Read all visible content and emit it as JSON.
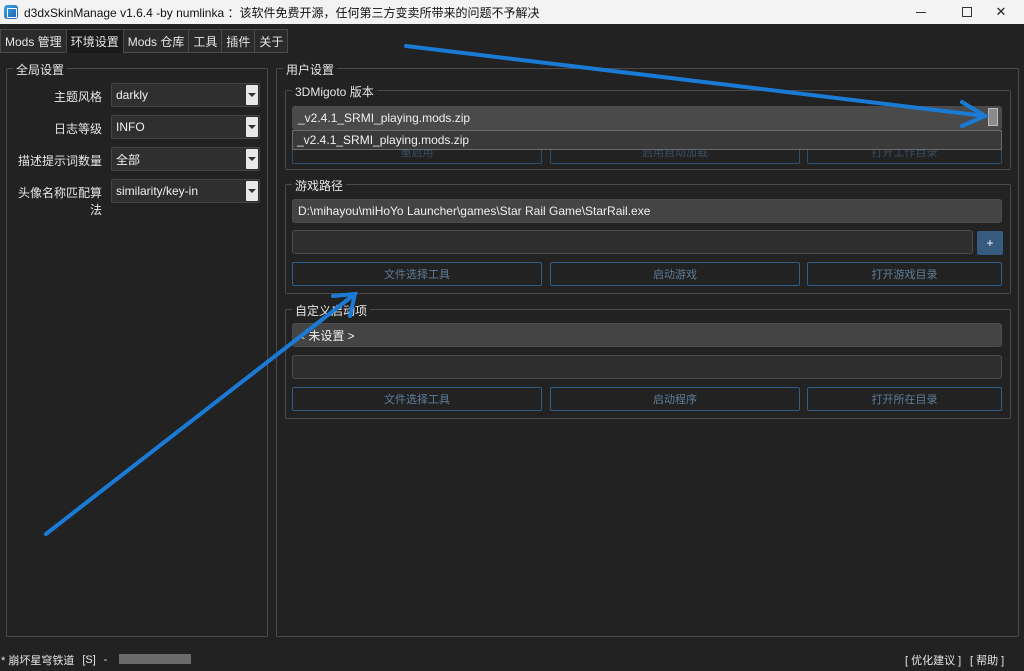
{
  "window": {
    "title": "d3dxSkinManage v1.6.4 -by numlinka ：该软件免费开源，任何第三方变卖所带来的问题不予解决",
    "min_icon": "minimize-icon",
    "max_icon": "maximize-icon",
    "close_glyph": "✕"
  },
  "tabs": [
    {
      "label": "Mods 管理"
    },
    {
      "label": "环境设置"
    },
    {
      "label": "Mods 仓库"
    },
    {
      "label": "工具"
    },
    {
      "label": "插件"
    },
    {
      "label": "关于"
    }
  ],
  "global": {
    "title": "全局设置",
    "rows": [
      {
        "label": "主题风格",
        "value": "darkly"
      },
      {
        "label": "日志等级",
        "value": "INFO"
      },
      {
        "label": "描述提示词数量",
        "value": "全部"
      },
      {
        "label": "头像名称匹配算法",
        "value": "similarity/key-in"
      }
    ]
  },
  "user": {
    "title": "用户设置",
    "migoto": {
      "title": "3DMigoto 版本",
      "selected": "_v2.4.1_SRMI_playing.mods.zip",
      "dropdown_item": "_v2.4.1_SRMI_playing.mods.zip",
      "buttons": [
        "重启用",
        "启用自动加载",
        "打开工作目录"
      ]
    },
    "game": {
      "title": "游戏路径",
      "path": "D:\\mihayou\\miHoYo Launcher\\games\\Star Rail Game\\StarRail.exe",
      "args": "",
      "plus": "+",
      "buttons": [
        "文件选择工具",
        "启动游戏",
        "打开游戏目录"
      ]
    },
    "custom": {
      "title": "自定义启动项",
      "value": "< 未设置 >",
      "args": "",
      "buttons": [
        "文件选择工具",
        "启动程序",
        "打开所在目录"
      ]
    }
  },
  "status": {
    "left": "* 崩坏星穹铁道",
    "mode": "[S]",
    "dash": "-",
    "right1": "[ 优化建议 ]",
    "right2": "[ 帮助 ]"
  },
  "colors": {
    "accent": "#375a7f",
    "annotation_arrow": "#1a7bd6"
  }
}
